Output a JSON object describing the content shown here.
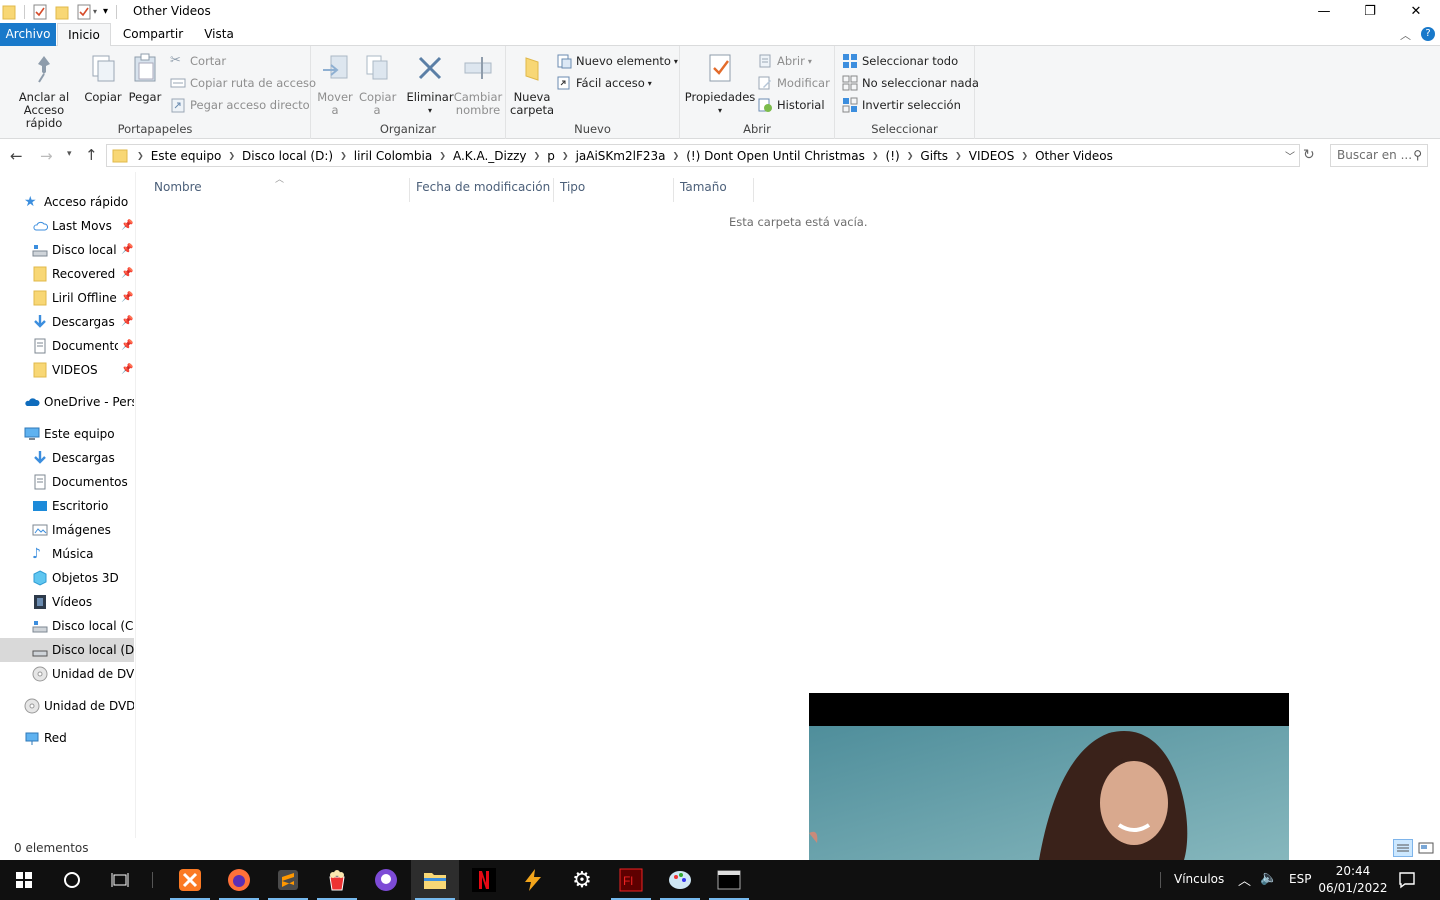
{
  "window": {
    "title": "Other Videos",
    "minimize_glyph": "—",
    "restore_glyph": "❐",
    "close_glyph": "✕"
  },
  "tabs": [
    {
      "label": "Archivo"
    },
    {
      "label": "Inicio"
    },
    {
      "label": "Compartir"
    },
    {
      "label": "Vista"
    }
  ],
  "ribbon": {
    "portapapeles": {
      "label": "Portapapeles",
      "pin": "Anclar al\nAcceso rápido",
      "copy": "Copiar",
      "paste": "Pegar",
      "cut": "Cortar",
      "copy_path": "Copiar ruta de acceso",
      "paste_shortcut": "Pegar acceso directo"
    },
    "organizar": {
      "label": "Organizar",
      "move": "Mover\na",
      "copy_to": "Copiar\na",
      "delete": "Eliminar",
      "rename": "Cambiar\nnombre"
    },
    "nuevo": {
      "label": "Nuevo",
      "new_folder": "Nueva\ncarpeta",
      "new_item": "Nuevo elemento",
      "easy_access": "Fácil acceso"
    },
    "abrir": {
      "label": "Abrir",
      "properties": "Propiedades",
      "open": "Abrir",
      "edit": "Modificar",
      "history": "Historial"
    },
    "seleccionar": {
      "label": "Seleccionar",
      "select_all": "Seleccionar todo",
      "select_none": "No seleccionar nada",
      "invert": "Invertir selección"
    }
  },
  "address": {
    "breadcrumbs": [
      "Este equipo",
      "Disco local (D:)",
      "liril Colombia",
      "A.K.A._Dizzy",
      "p",
      "jaAiSKm2lF23a",
      "(!) Dont Open Until Christmas",
      "(!)",
      "Gifts",
      "VIDEOS",
      "Other Videos"
    ],
    "search_placeholder": "Buscar en ..."
  },
  "nav": {
    "quick_access": "Acceso rápido",
    "quick_items": [
      {
        "label": "Last Movs",
        "icon": "cloud-icon"
      },
      {
        "label": "Disco local (",
        "icon": "drive-icon"
      },
      {
        "label": "Recovered",
        "icon": "folder-icon"
      },
      {
        "label": "Liril Offline",
        "icon": "folder-icon"
      },
      {
        "label": "Descargas",
        "icon": "download-icon"
      },
      {
        "label": "Documentos",
        "icon": "document-icon"
      },
      {
        "label": "VIDEOS",
        "icon": "folder-icon"
      }
    ],
    "onedrive": "OneDrive - Perso",
    "this_pc": "Este equipo",
    "pc_items": [
      {
        "label": "Descargas"
      },
      {
        "label": "Documentos"
      },
      {
        "label": "Escritorio"
      },
      {
        "label": "Imágenes"
      },
      {
        "label": "Música"
      },
      {
        "label": "Objetos 3D"
      },
      {
        "label": "Vídeos"
      },
      {
        "label": "Disco local (C:)"
      },
      {
        "label": "Disco local (D:)"
      },
      {
        "label": "Unidad de DVD"
      }
    ],
    "dvd_root": "Unidad de DVD R",
    "network": "Red"
  },
  "columns": {
    "name": "Nombre",
    "modified": "Fecha de modificación",
    "type": "Tipo",
    "size": "Tamaño"
  },
  "content": {
    "empty_message": "Esta carpeta está vacía."
  },
  "status": {
    "count": "0 elementos"
  },
  "taskbar": {
    "links": "Vínculos",
    "language": "ESP",
    "time": "20:44",
    "date": "06/01/2022"
  },
  "colors": {
    "accent": "#1979ca",
    "taskbar": "#101010"
  }
}
